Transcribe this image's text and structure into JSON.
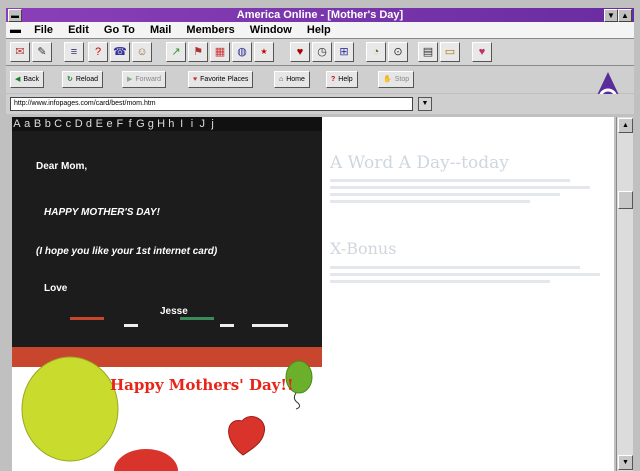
{
  "window": {
    "title": "America  Online - [Mother's Day]"
  },
  "menu": [
    "File",
    "Edit",
    "Go To",
    "Mail",
    "Members",
    "Window",
    "Help"
  ],
  "toolbar_icons": [
    "mailbox-icon",
    "compose-icon",
    "text-icon",
    "help-icon",
    "chat-icon",
    "people-icon",
    "stocks-icon",
    "sports-icon",
    "news-icon",
    "globe-icon",
    "new-icon",
    "favorites-icon",
    "clock-icon",
    "network-icon",
    "bell-icon",
    "magnify-icon",
    "print-icon",
    "folder-icon",
    "heart-icon"
  ],
  "nav": {
    "back": "Back",
    "reload": "Reload",
    "forward": "Forward",
    "favorite": "Favorite Places",
    "home": "Home",
    "help": "Help",
    "stop": "Stop"
  },
  "address": {
    "url": "http://www.infopages.com/card/best/mom.htm"
  },
  "alphabet": [
    "A",
    "a",
    "B",
    "b",
    "C",
    "c",
    "D",
    "d",
    "E",
    "e",
    "F",
    "f",
    "G",
    "g",
    "H",
    "h",
    "I",
    "i",
    "J",
    "j"
  ],
  "card": {
    "greeting": "Dear Mom,",
    "headline": "HAPPY MOTHER'S DAY!",
    "note": "(I hope you like your 1st internet card)",
    "closing": "Love",
    "signature": "Jesse"
  },
  "background_page": {
    "heading1": "A Word A Day--today",
    "heading2": "X-Bonus"
  },
  "bottom": {
    "banner": "Happy Mothers' Day!!"
  },
  "colors": {
    "title_bar": "#7a36ac",
    "card_bg": "#1c1c1c",
    "banner_red": "#e8241a",
    "balloon_yellow": "#c9dc2e",
    "balloon_green": "#6ab02a",
    "heart_red": "#d9342b"
  }
}
